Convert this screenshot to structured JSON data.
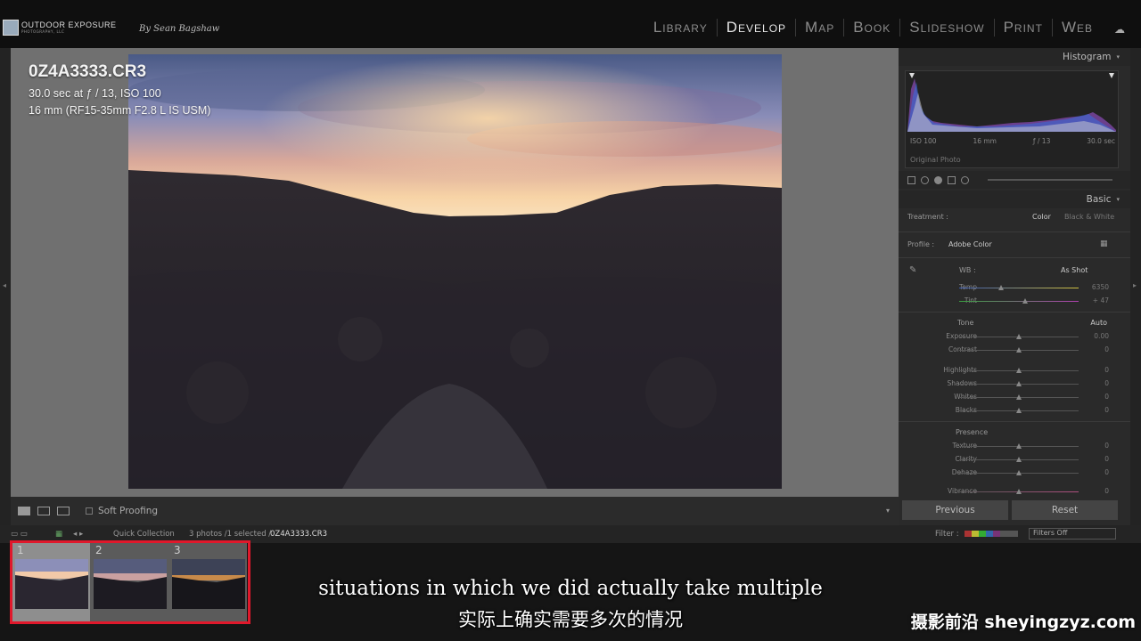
{
  "brand": {
    "logo_line1": "OUTDOOR EXPOSURE",
    "logo_line2": "PHOTOGRAPHY, LLC",
    "byline": "By Sean Bagshaw"
  },
  "modules": [
    "Library",
    "Develop",
    "Map",
    "Book",
    "Slideshow",
    "Print",
    "Web"
  ],
  "active_module": "Develop",
  "photo_info": {
    "filename": "0Z4A3333.CR3",
    "exposure": "30.0 sec at ƒ / 13, ISO 100",
    "lens": "16 mm (RF15-35mm F2.8 L IS USM)"
  },
  "toolbar": {
    "soft_proofing": "Soft Proofing"
  },
  "right_panel": {
    "histogram_title": "Histogram",
    "histogram_meta": [
      "ISO 100",
      "16 mm",
      "ƒ / 13",
      "30.0 sec"
    ],
    "original_photo": "Original Photo",
    "basic_title": "Basic",
    "treatment_label": "Treatment :",
    "treatment_color": "Color",
    "treatment_bw": "Black & White",
    "profile_label": "Profile :",
    "profile_value": "Adobe Color",
    "wb_label": "WB :",
    "wb_value": "As Shot",
    "temp": {
      "label": "Temp",
      "value": "6350",
      "pos": 0.35
    },
    "tint": {
      "label": "Tint",
      "value": "+ 47",
      "pos": 0.55
    },
    "tone_title": "Tone",
    "tone_auto": "Auto",
    "tone_sliders": [
      {
        "label": "Exposure",
        "value": "0.00",
        "pos": 0.5
      },
      {
        "label": "Contrast",
        "value": "0",
        "pos": 0.5
      }
    ],
    "tone_sliders2": [
      {
        "label": "Highlights",
        "value": "0",
        "pos": 0.5
      },
      {
        "label": "Shadows",
        "value": "0",
        "pos": 0.5
      },
      {
        "label": "Whites",
        "value": "0",
        "pos": 0.5
      },
      {
        "label": "Blacks",
        "value": "0",
        "pos": 0.5
      }
    ],
    "presence_title": "Presence",
    "presence_sliders": [
      {
        "label": "Texture",
        "value": "0",
        "pos": 0.5
      },
      {
        "label": "Clarity",
        "value": "0",
        "pos": 0.5
      },
      {
        "label": "Dehaze",
        "value": "0",
        "pos": 0.5
      }
    ],
    "vibrance": {
      "label": "Vibrance",
      "value": "0",
      "pos": 0.5
    },
    "previous_button": "Previous",
    "reset_button": "Reset"
  },
  "filmstrip_bar": {
    "source": "Quick Collection",
    "count": "3 photos /1 selected /",
    "selected_file": "0Z4A3333.CR3",
    "filter_label": "Filter :",
    "filter_value": "Filters Off"
  },
  "thumbnails": [
    {
      "num": "1",
      "selected": true
    },
    {
      "num": "2",
      "selected": false
    },
    {
      "num": "3",
      "selected": false
    }
  ],
  "subtitles": {
    "en": "situations in which we did actually take multiple",
    "zh": "实际上确实需要多次的情况"
  },
  "watermark": "摄影前沿 sheyingzyz.com"
}
